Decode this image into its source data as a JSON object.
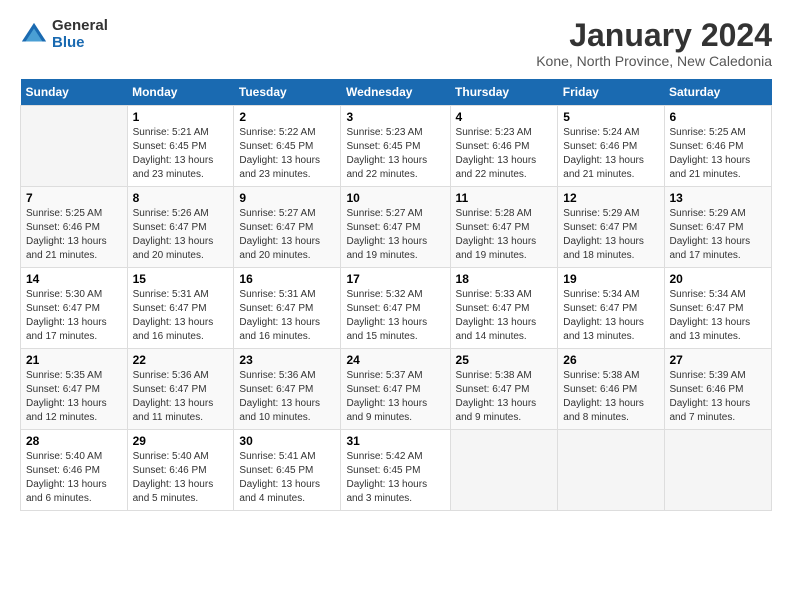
{
  "header": {
    "logo_general": "General",
    "logo_blue": "Blue",
    "title": "January 2024",
    "subtitle": "Kone, North Province, New Caledonia"
  },
  "days_of_week": [
    "Sunday",
    "Monday",
    "Tuesday",
    "Wednesday",
    "Thursday",
    "Friday",
    "Saturday"
  ],
  "weeks": [
    [
      {
        "num": "",
        "sunrise": "",
        "sunset": "",
        "daylight": "",
        "empty": true
      },
      {
        "num": "1",
        "sunrise": "Sunrise: 5:21 AM",
        "sunset": "Sunset: 6:45 PM",
        "daylight": "Daylight: 13 hours and 23 minutes."
      },
      {
        "num": "2",
        "sunrise": "Sunrise: 5:22 AM",
        "sunset": "Sunset: 6:45 PM",
        "daylight": "Daylight: 13 hours and 23 minutes."
      },
      {
        "num": "3",
        "sunrise": "Sunrise: 5:23 AM",
        "sunset": "Sunset: 6:45 PM",
        "daylight": "Daylight: 13 hours and 22 minutes."
      },
      {
        "num": "4",
        "sunrise": "Sunrise: 5:23 AM",
        "sunset": "Sunset: 6:46 PM",
        "daylight": "Daylight: 13 hours and 22 minutes."
      },
      {
        "num": "5",
        "sunrise": "Sunrise: 5:24 AM",
        "sunset": "Sunset: 6:46 PM",
        "daylight": "Daylight: 13 hours and 21 minutes."
      },
      {
        "num": "6",
        "sunrise": "Sunrise: 5:25 AM",
        "sunset": "Sunset: 6:46 PM",
        "daylight": "Daylight: 13 hours and 21 minutes."
      }
    ],
    [
      {
        "num": "7",
        "sunrise": "Sunrise: 5:25 AM",
        "sunset": "Sunset: 6:46 PM",
        "daylight": "Daylight: 13 hours and 21 minutes."
      },
      {
        "num": "8",
        "sunrise": "Sunrise: 5:26 AM",
        "sunset": "Sunset: 6:47 PM",
        "daylight": "Daylight: 13 hours and 20 minutes."
      },
      {
        "num": "9",
        "sunrise": "Sunrise: 5:27 AM",
        "sunset": "Sunset: 6:47 PM",
        "daylight": "Daylight: 13 hours and 20 minutes."
      },
      {
        "num": "10",
        "sunrise": "Sunrise: 5:27 AM",
        "sunset": "Sunset: 6:47 PM",
        "daylight": "Daylight: 13 hours and 19 minutes."
      },
      {
        "num": "11",
        "sunrise": "Sunrise: 5:28 AM",
        "sunset": "Sunset: 6:47 PM",
        "daylight": "Daylight: 13 hours and 19 minutes."
      },
      {
        "num": "12",
        "sunrise": "Sunrise: 5:29 AM",
        "sunset": "Sunset: 6:47 PM",
        "daylight": "Daylight: 13 hours and 18 minutes."
      },
      {
        "num": "13",
        "sunrise": "Sunrise: 5:29 AM",
        "sunset": "Sunset: 6:47 PM",
        "daylight": "Daylight: 13 hours and 17 minutes."
      }
    ],
    [
      {
        "num": "14",
        "sunrise": "Sunrise: 5:30 AM",
        "sunset": "Sunset: 6:47 PM",
        "daylight": "Daylight: 13 hours and 17 minutes."
      },
      {
        "num": "15",
        "sunrise": "Sunrise: 5:31 AM",
        "sunset": "Sunset: 6:47 PM",
        "daylight": "Daylight: 13 hours and 16 minutes."
      },
      {
        "num": "16",
        "sunrise": "Sunrise: 5:31 AM",
        "sunset": "Sunset: 6:47 PM",
        "daylight": "Daylight: 13 hours and 16 minutes."
      },
      {
        "num": "17",
        "sunrise": "Sunrise: 5:32 AM",
        "sunset": "Sunset: 6:47 PM",
        "daylight": "Daylight: 13 hours and 15 minutes."
      },
      {
        "num": "18",
        "sunrise": "Sunrise: 5:33 AM",
        "sunset": "Sunset: 6:47 PM",
        "daylight": "Daylight: 13 hours and 14 minutes."
      },
      {
        "num": "19",
        "sunrise": "Sunrise: 5:34 AM",
        "sunset": "Sunset: 6:47 PM",
        "daylight": "Daylight: 13 hours and 13 minutes."
      },
      {
        "num": "20",
        "sunrise": "Sunrise: 5:34 AM",
        "sunset": "Sunset: 6:47 PM",
        "daylight": "Daylight: 13 hours and 13 minutes."
      }
    ],
    [
      {
        "num": "21",
        "sunrise": "Sunrise: 5:35 AM",
        "sunset": "Sunset: 6:47 PM",
        "daylight": "Daylight: 13 hours and 12 minutes."
      },
      {
        "num": "22",
        "sunrise": "Sunrise: 5:36 AM",
        "sunset": "Sunset: 6:47 PM",
        "daylight": "Daylight: 13 hours and 11 minutes."
      },
      {
        "num": "23",
        "sunrise": "Sunrise: 5:36 AM",
        "sunset": "Sunset: 6:47 PM",
        "daylight": "Daylight: 13 hours and 10 minutes."
      },
      {
        "num": "24",
        "sunrise": "Sunrise: 5:37 AM",
        "sunset": "Sunset: 6:47 PM",
        "daylight": "Daylight: 13 hours and 9 minutes."
      },
      {
        "num": "25",
        "sunrise": "Sunrise: 5:38 AM",
        "sunset": "Sunset: 6:47 PM",
        "daylight": "Daylight: 13 hours and 9 minutes."
      },
      {
        "num": "26",
        "sunrise": "Sunrise: 5:38 AM",
        "sunset": "Sunset: 6:46 PM",
        "daylight": "Daylight: 13 hours and 8 minutes."
      },
      {
        "num": "27",
        "sunrise": "Sunrise: 5:39 AM",
        "sunset": "Sunset: 6:46 PM",
        "daylight": "Daylight: 13 hours and 7 minutes."
      }
    ],
    [
      {
        "num": "28",
        "sunrise": "Sunrise: 5:40 AM",
        "sunset": "Sunset: 6:46 PM",
        "daylight": "Daylight: 13 hours and 6 minutes."
      },
      {
        "num": "29",
        "sunrise": "Sunrise: 5:40 AM",
        "sunset": "Sunset: 6:46 PM",
        "daylight": "Daylight: 13 hours and 5 minutes."
      },
      {
        "num": "30",
        "sunrise": "Sunrise: 5:41 AM",
        "sunset": "Sunset: 6:45 PM",
        "daylight": "Daylight: 13 hours and 4 minutes."
      },
      {
        "num": "31",
        "sunrise": "Sunrise: 5:42 AM",
        "sunset": "Sunset: 6:45 PM",
        "daylight": "Daylight: 13 hours and 3 minutes."
      },
      {
        "num": "",
        "sunrise": "",
        "sunset": "",
        "daylight": "",
        "empty": true
      },
      {
        "num": "",
        "sunrise": "",
        "sunset": "",
        "daylight": "",
        "empty": true
      },
      {
        "num": "",
        "sunrise": "",
        "sunset": "",
        "daylight": "",
        "empty": true
      }
    ]
  ]
}
